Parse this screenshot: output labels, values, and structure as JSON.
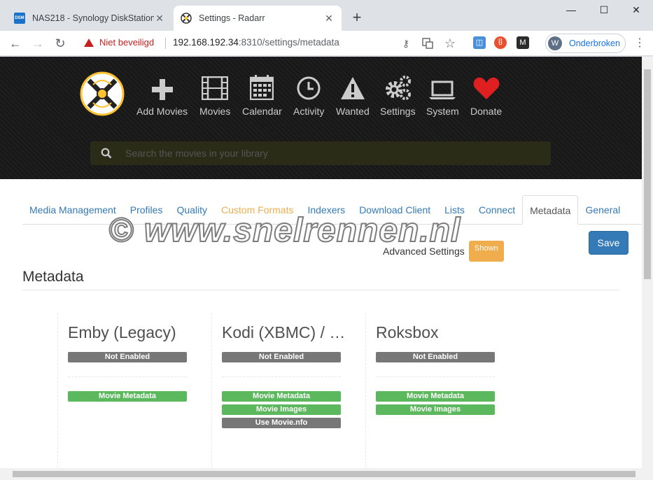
{
  "browser": {
    "tabs": [
      {
        "title": "NAS218 - Synology DiskStation",
        "favicon": "DSM",
        "active": false
      },
      {
        "title": "Settings - Radarr",
        "active": true
      }
    ],
    "security_label": "Niet beveiligd",
    "url_host": "192.168.192.34",
    "url_rest": ":8310/settings/metadata",
    "profile": {
      "initial": "W",
      "label": "Onderbroken"
    }
  },
  "nav": {
    "items": [
      {
        "label": "Add Movies",
        "icon": "plus-icon"
      },
      {
        "label": "Movies",
        "icon": "film-icon"
      },
      {
        "label": "Calendar",
        "icon": "calendar-icon"
      },
      {
        "label": "Activity",
        "icon": "clock-icon"
      },
      {
        "label": "Wanted",
        "icon": "warning-icon"
      },
      {
        "label": "Settings",
        "icon": "cogs-icon"
      },
      {
        "label": "System",
        "icon": "laptop-icon"
      },
      {
        "label": "Donate",
        "icon": "heart-icon"
      }
    ],
    "search_placeholder": "Search the movies in your library"
  },
  "settings_tabs": [
    {
      "label": "Media Management"
    },
    {
      "label": "Profiles"
    },
    {
      "label": "Quality"
    },
    {
      "label": "Custom Formats"
    },
    {
      "label": "Indexers"
    },
    {
      "label": "Download Client"
    },
    {
      "label": "Lists"
    },
    {
      "label": "Connect"
    },
    {
      "label": "Metadata"
    },
    {
      "label": "General"
    }
  ],
  "advanced": {
    "label": "Advanced Settings",
    "toggle": "Shown"
  },
  "save_label": "Save",
  "section_title": "Metadata",
  "cards": [
    {
      "title": "Emby (Legacy)",
      "status": "Not Enabled",
      "tags": [
        "Movie Metadata"
      ]
    },
    {
      "title": "Kodi (XBMC) / Emby",
      "status": "Not Enabled",
      "tags": [
        "Movie Metadata",
        "Movie Images",
        "Use Movie.nfo"
      ]
    },
    {
      "title": "Roksbox",
      "status": "Not Enabled",
      "tags": [
        "Movie Metadata",
        "Movie Images"
      ]
    }
  ],
  "watermark": "© www.snelrennen.nl",
  "colors": {
    "primary": "#337ab7",
    "success": "#5cb85c",
    "warning": "#f0ad4e",
    "default": "#777777",
    "donate": "#e02020"
  }
}
